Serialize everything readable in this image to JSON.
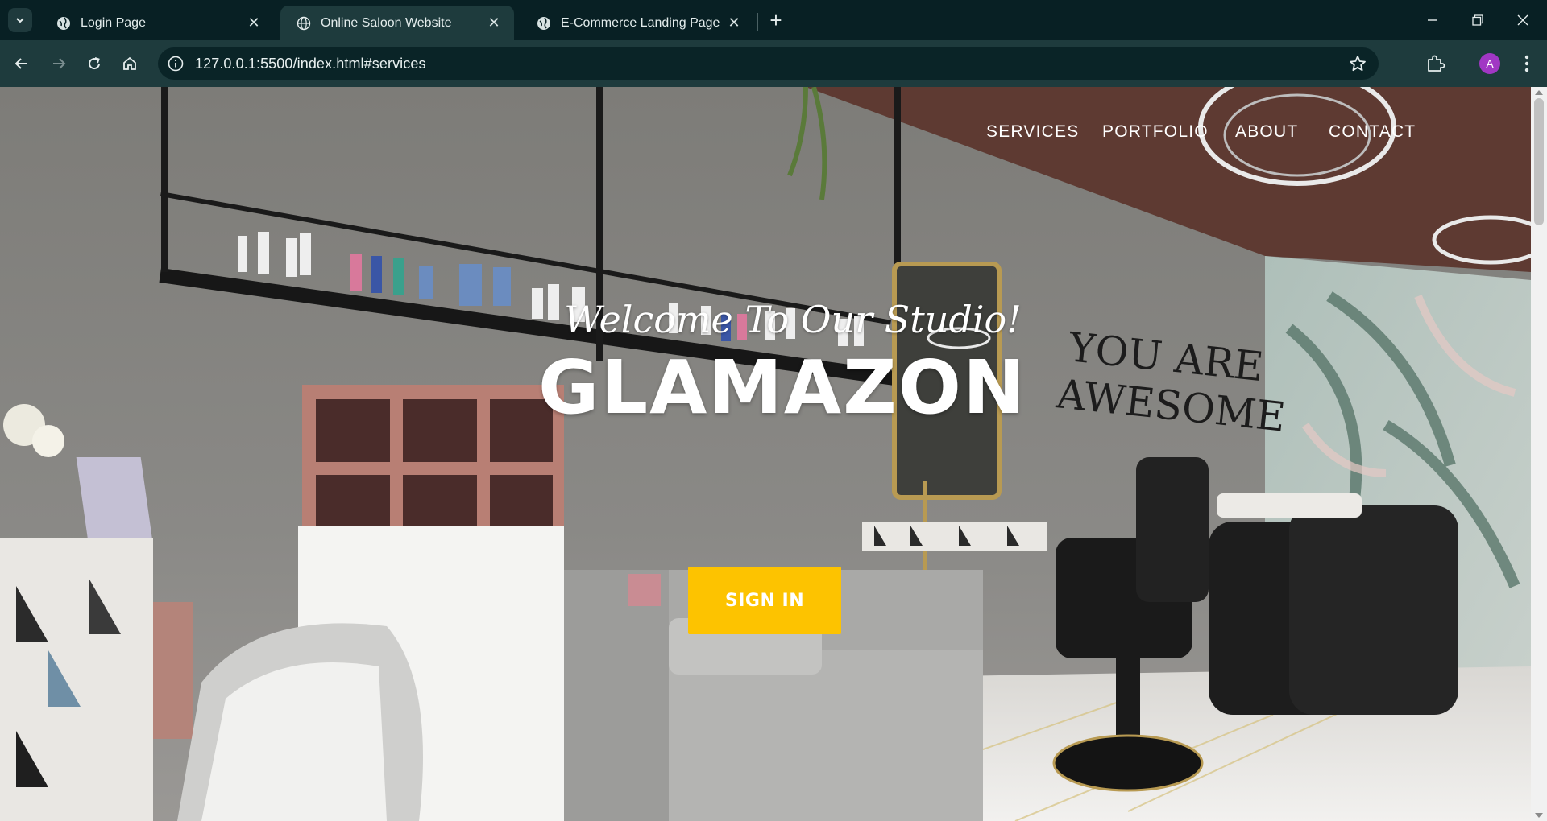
{
  "browser": {
    "tabs": [
      {
        "title": "Login Page",
        "active": false
      },
      {
        "title": "Online Saloon Website",
        "active": true
      },
      {
        "title": "E-Commerce Landing Page",
        "active": false
      }
    ],
    "url": "127.0.0.1:5500/index.html#services",
    "profile_initial": "A",
    "profile_color": "#a137c4"
  },
  "site": {
    "nav": [
      "SERVICES",
      "PORTFOLIO",
      "ABOUT",
      "CONTACT"
    ],
    "tagline": "Welcome To Our Studio!",
    "brand": "GLAMAZON",
    "cta_label": "SIGN IN",
    "wall_text_line1": "YOU ARE",
    "wall_text_line2": "AWESOME",
    "accent_color": "#fdc300"
  }
}
